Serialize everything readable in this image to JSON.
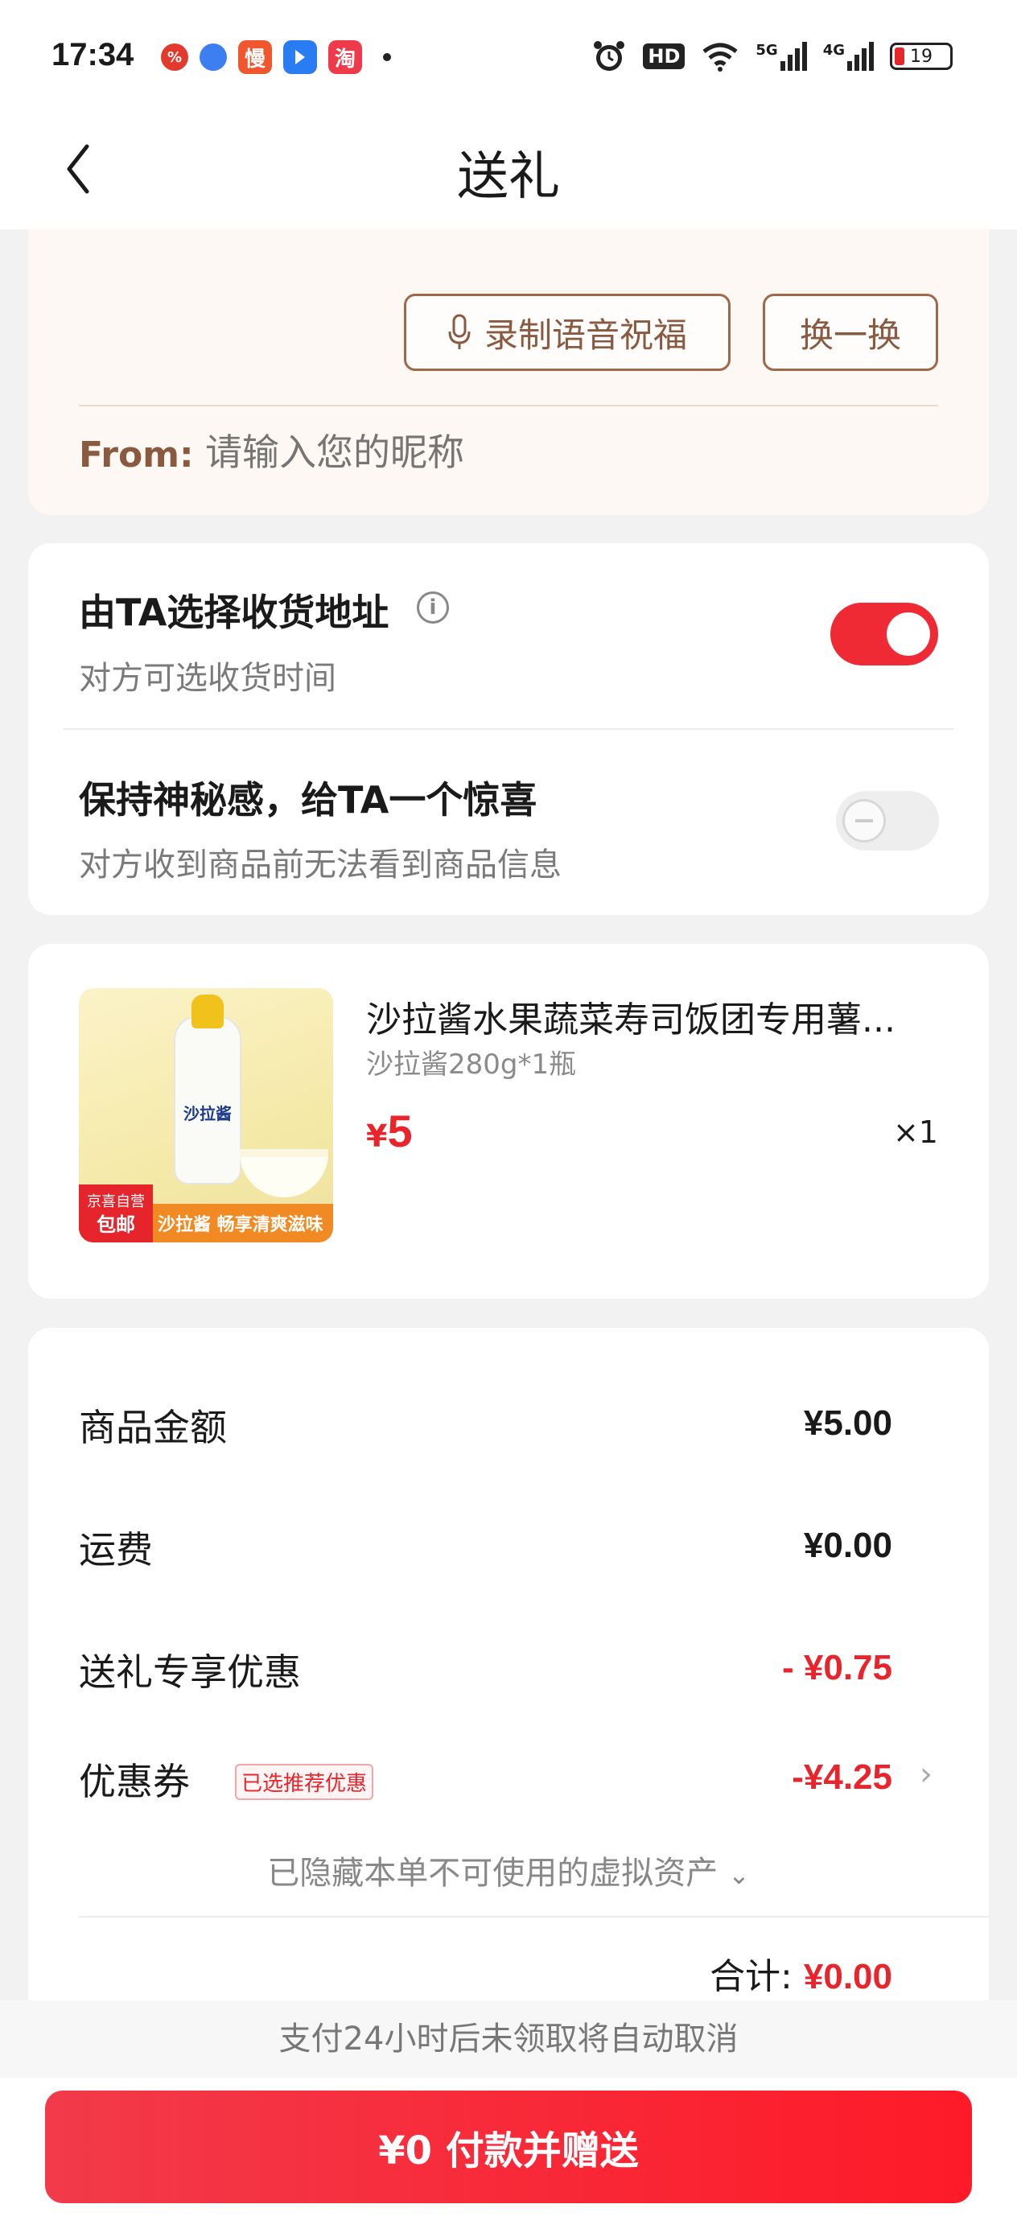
{
  "status_bar": {
    "time": "17:34",
    "apps": [
      {
        "icon": "pinduoduo-icon",
        "label": "%",
        "color": "#e23b2e"
      },
      {
        "icon": "browser-icon",
        "label": "",
        "color": "#3d7ef0"
      },
      {
        "icon": "man-app-icon",
        "label": "慢",
        "color": "#f0572e"
      },
      {
        "icon": "direction-app-icon",
        "label": "",
        "color": "#2a7cf2"
      },
      {
        "icon": "taobao-icon",
        "label": "淘",
        "color": "#ee3a4a"
      }
    ],
    "signal_5g": "5G",
    "signal_4g": "4G",
    "hd_label": "HD",
    "battery_level": "19"
  },
  "header": {
    "title": "送礼"
  },
  "message_card": {
    "voice_button": "录制语音祝福",
    "swap_button": "换一换",
    "from_label": "From:",
    "from_placeholder": "请输入您的昵称",
    "from_value": ""
  },
  "options": [
    {
      "title": "由TA选择收货地址",
      "subtitle": "对方可选收货时间",
      "enabled": true
    },
    {
      "title": "保持神秘感，给TA一个惊喜",
      "subtitle": "对方收到商品前无法看到商品信息",
      "enabled": false
    }
  ],
  "product": {
    "name": "沙拉酱水果蔬菜寿司饭团专用薯...",
    "spec": "沙拉酱280g*1瓶",
    "price_symbol": "¥",
    "price": "5",
    "quantity": "×1",
    "image_label": "沙拉酱",
    "promo_store": "京喜自营",
    "promo_free_shipping": "包邮",
    "promo_text": "沙拉酱 畅享清爽滋味",
    "colors": {
      "price": "#e8242c"
    }
  },
  "summary": {
    "rows": [
      {
        "label": "商品金额",
        "value": "¥5.00",
        "highlight": false
      },
      {
        "label": "运费",
        "value": "¥0.00",
        "highlight": false
      },
      {
        "label": "送礼专享优惠",
        "value": "- ¥0.75",
        "highlight": true
      },
      {
        "label": "优惠券",
        "value": "-¥4.25",
        "highlight": true,
        "tag": "已选推荐优惠"
      }
    ],
    "hidden_assets": "已隐藏本单不可使用的虚拟资产",
    "total_label": "合计:",
    "total_value": "¥0.00"
  },
  "footer": {
    "notice": "支付24小时后未领取将自动取消",
    "pay_button": "¥0 付款并赠送",
    "colors": {
      "accent": "#fe1a28"
    }
  }
}
